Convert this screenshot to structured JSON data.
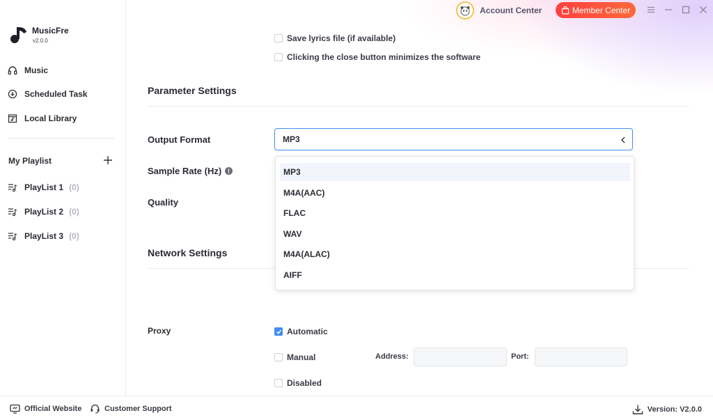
{
  "brand": {
    "name": "MusicFre",
    "version": "v2.0.0"
  },
  "nav": [
    {
      "label": "Music",
      "icon": "headphones-icon"
    },
    {
      "label": "Scheduled Task",
      "icon": "clock-download-icon"
    },
    {
      "label": "Local Library",
      "icon": "folder-music-icon"
    }
  ],
  "playlists": {
    "title": "My Playlist",
    "items": [
      {
        "label": "PlayList 1",
        "count": "(0)"
      },
      {
        "label": "PlayList 2",
        "count": "(0)"
      },
      {
        "label": "PlayList 3",
        "count": "(0)"
      }
    ]
  },
  "titlebar": {
    "account_label": "Account Center",
    "member_label": "Member Center"
  },
  "options": {
    "save_lyrics": "Save lyrics file (if available)",
    "close_minimizes": "Clicking the close button minimizes the software"
  },
  "parameter": {
    "title": "Parameter Settings",
    "output_format_label": "Output Format",
    "output_format_value": "MP3",
    "sample_rate_label": "Sample Rate (Hz)",
    "quality_label": "Quality",
    "format_options": [
      "MP3",
      "M4A(AAC)",
      "FLAC",
      "WAV",
      "M4A(ALAC)",
      "AIFF"
    ]
  },
  "network": {
    "title": "Network Settings",
    "proxy_label": "Proxy",
    "automatic": "Automatic",
    "manual": "Manual",
    "disabled": "Disabled",
    "address_label": "Address:",
    "port_label": "Port:",
    "address_value": "",
    "port_value": ""
  },
  "footer": {
    "website": "Official Website",
    "support": "Customer Support",
    "version": "Version: V2.0.0"
  },
  "colors": {
    "accent": "#3e8df5",
    "member": "#ff4a3d"
  }
}
